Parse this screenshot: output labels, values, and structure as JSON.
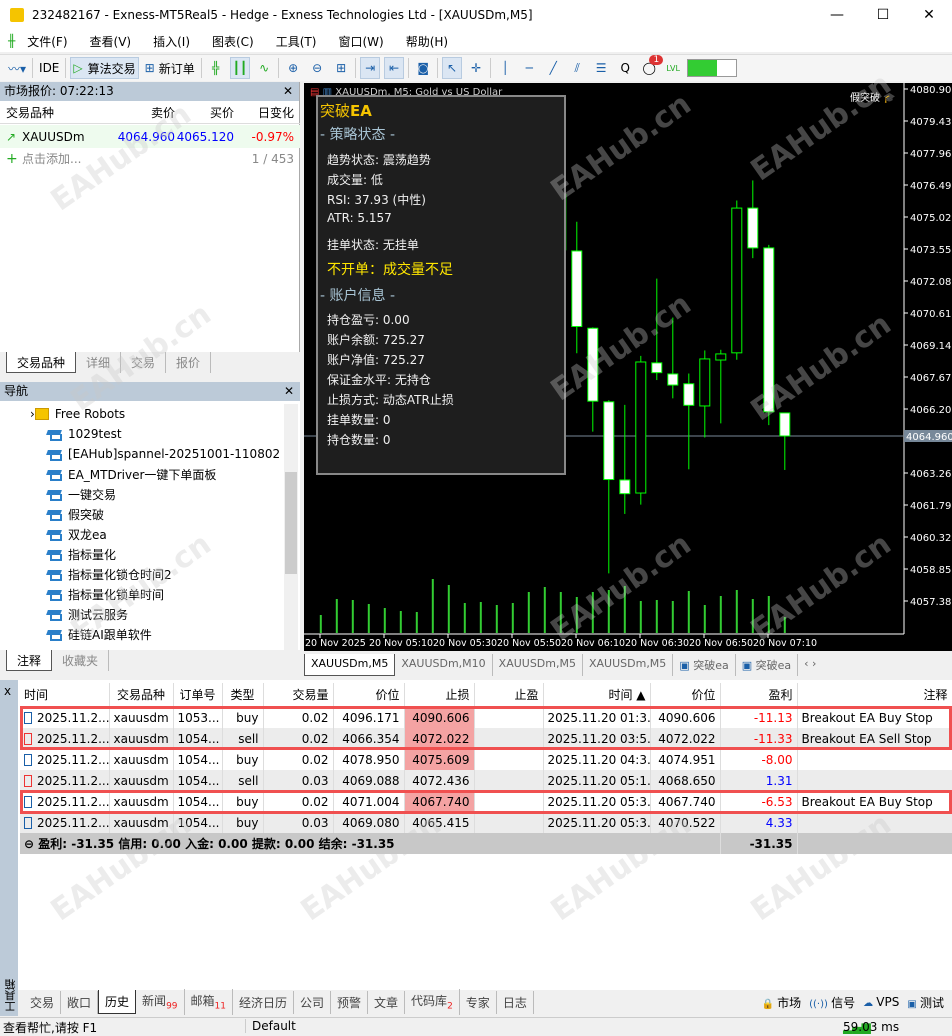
{
  "window": {
    "title": "232482167 - Exness-MT5Real5 - Hedge - Exness Technologies Ltd - [XAUUSDm,M5]",
    "min": "—",
    "max": "☐",
    "close": "✕"
  },
  "menu": [
    "文件(F)",
    "查看(V)",
    "插入(I)",
    "图表(C)",
    "工具(T)",
    "窗口(W)",
    "帮助(H)"
  ],
  "toolbar": {
    "ide": "IDE",
    "algo": "算法交易",
    "new_order": "新订单",
    "notif_count": "1",
    "lvl": "LVL"
  },
  "market_watch": {
    "title": "市场报价: 07:22:13",
    "columns": [
      "交易品种",
      "卖价",
      "买价",
      "日变化"
    ],
    "rows": [
      {
        "symbol": "XAUUSDm",
        "bid": "4064.960",
        "ask": "4065.120",
        "change": "-0.97%"
      }
    ],
    "add": "点击添加...",
    "count": "1 / 453",
    "tabs": [
      "交易品种",
      "详细",
      "交易",
      "报价"
    ]
  },
  "navigator": {
    "title": "导航",
    "items": [
      "Free Robots",
      "1029test",
      "[EAHub]spannel-20251001-110802",
      "EA_MTDriver一键下单面板",
      "一键交易",
      "假突破",
      "双龙ea",
      "指标量化",
      "指标量化锁仓时间2",
      "指标量化锁单时间",
      "测试云服务",
      "硅链AI跟单软件"
    ],
    "tabs": [
      "注释",
      "收藏夹"
    ]
  },
  "chart": {
    "header": "XAUUSDm, M5: Gold vs US Dollar",
    "ea_label": "假突破",
    "current_price": "4064.960",
    "colors": {
      "bg": "#000000",
      "candle": "#00ff00",
      "bear_fill": "#ffffff",
      "volume": "#32cd32",
      "bid_line": "#778899"
    },
    "price_labels": [
      "4080.900",
      "4079.430",
      "4077.960",
      "4076.490",
      "4075.020",
      "4073.550",
      "4072.080",
      "4070.610",
      "4069.140",
      "4067.670",
      "4066.200",
      "4063.260",
      "4061.790",
      "4060.320",
      "4058.850",
      "4057.380"
    ],
    "time_labels": [
      "20 Nov 2025",
      "20 Nov 05:10",
      "20 Nov 05:30",
      "20 Nov 05:50",
      "20 Nov 06:10",
      "20 Nov 06:30",
      "20 Nov 06:50",
      "20 Nov 07:10"
    ]
  },
  "chart_data": {
    "type": "candlestick",
    "ylim": [
      4056.5,
      4081.2
    ],
    "candles": [
      {
        "t": "06:10",
        "o": 4073.51,
        "h": 4076.3,
        "l": 4073.3,
        "c": 4076.06
      },
      {
        "t": "06:15",
        "o": 4073.46,
        "h": 4074.8,
        "l": 4068.76,
        "c": 4069.99
      },
      {
        "t": "06:20",
        "o": 4069.91,
        "h": 4069.95,
        "l": 4065.16,
        "c": 4066.56
      },
      {
        "t": "06:25",
        "o": 4066.53,
        "h": 4066.6,
        "l": 4058.65,
        "c": 4062.96
      },
      {
        "t": "06:30",
        "o": 4062.94,
        "h": 4066.39,
        "l": 4061.38,
        "c": 4062.31
      },
      {
        "t": "06:35",
        "o": 4062.34,
        "h": 4068.64,
        "l": 4061.81,
        "c": 4068.36
      },
      {
        "t": "06:40",
        "o": 4068.32,
        "h": 4072.19,
        "l": 4067.53,
        "c": 4067.87
      },
      {
        "t": "06:45",
        "o": 4067.81,
        "h": 4070.4,
        "l": 4066.69,
        "c": 4067.3
      },
      {
        "t": "06:50",
        "o": 4067.36,
        "h": 4067.83,
        "l": 4063.43,
        "c": 4066.37
      },
      {
        "t": "06:55",
        "o": 4066.34,
        "h": 4068.89,
        "l": 4064.89,
        "c": 4068.5
      },
      {
        "t": "07:00",
        "o": 4068.45,
        "h": 4068.92,
        "l": 4065.54,
        "c": 4068.73
      },
      {
        "t": "07:05",
        "o": 4068.78,
        "h": 4075.78,
        "l": 4068.46,
        "c": 4075.43
      },
      {
        "t": "07:10",
        "o": 4075.43,
        "h": 4076.7,
        "l": 4073.13,
        "c": 4073.6
      },
      {
        "t": "07:15",
        "o": 4073.6,
        "h": 4073.74,
        "l": 4065.46,
        "c": 4066.07
      },
      {
        "t": "07:20",
        "o": 4066.02,
        "h": 4066.02,
        "l": 4063.4,
        "c": 4064.96
      }
    ],
    "volume": [
      18,
      34,
      33,
      29,
      25,
      22,
      21,
      54,
      48,
      30,
      31,
      28,
      30,
      41,
      46,
      41,
      36,
      41,
      43,
      47,
      32,
      33,
      32,
      42,
      28,
      37,
      43,
      34,
      37,
      16
    ]
  },
  "ea_panel": {
    "title": "突破",
    "title_bold": "EA",
    "sec1": "- 策略状态 -",
    "trend": "趋势状态: 震荡趋势",
    "volume": "成交量: 低",
    "rsi": "RSI: 37.93 (中性)",
    "atr": "ATR: 5.157",
    "pending": "挂单状态: 无挂单",
    "signal": "不开单：成交量不足",
    "sec2": "- 账户信息 -",
    "pnl": "持仓盈亏: 0.00",
    "balance": "账户余额: 725.27",
    "equity": "账户净值: 725.27",
    "margin": "保证金水平: 无持仓",
    "sl_mode": "止损方式: 动态ATR止损",
    "pend_count": "挂单数量: 0",
    "pos_count": "持仓数量: 0"
  },
  "chart_tabs": [
    "XAUUSDm,M5",
    "XAUUSDm,M10",
    "XAUUSDm,M5",
    "XAUUSDm,M5",
    "突破ea",
    "突破ea"
  ],
  "history": {
    "columns": [
      "时间",
      "交易品种",
      "订单号",
      "类型",
      "交易量",
      "价位",
      "止损",
      "止盈",
      "时间 ▲",
      "价位",
      "盈利",
      "注释"
    ],
    "rows": [
      [
        "2025.11.2...",
        "xauusdm",
        "1053...",
        "buy",
        "0.02",
        "4096.171",
        "4090.606",
        "",
        "2025.11.20 01:3...",
        "4090.606",
        "-11.13",
        "Breakout EA Buy Stop"
      ],
      [
        "2025.11.2...",
        "xauusdm",
        "1054...",
        "sell",
        "0.02",
        "4066.354",
        "4072.022",
        "",
        "2025.11.20 03:5...",
        "4072.022",
        "-11.33",
        "Breakout EA Sell Stop"
      ],
      [
        "2025.11.2...",
        "xauusdm",
        "1054...",
        "buy",
        "0.02",
        "4078.950",
        "4075.609",
        "",
        "2025.11.20 04:3...",
        "4074.951",
        "-8.00",
        ""
      ],
      [
        "2025.11.2...",
        "xauusdm",
        "1054...",
        "sell",
        "0.03",
        "4069.088",
        "4072.436",
        "",
        "2025.11.20 05:1...",
        "4068.650",
        "1.31",
        ""
      ],
      [
        "2025.11.2...",
        "xauusdm",
        "1054...",
        "buy",
        "0.02",
        "4071.004",
        "4067.740",
        "",
        "2025.11.20 05:3...",
        "4067.740",
        "-6.53",
        "Breakout EA Buy Stop"
      ],
      [
        "2025.11.2...",
        "xauusdm",
        "1054...",
        "buy",
        "0.03",
        "4069.080",
        "4065.415",
        "",
        "2025.11.20 05:3...",
        "4070.522",
        "4.33",
        ""
      ]
    ],
    "sl_hit": [
      true,
      true,
      true,
      false,
      true,
      false
    ],
    "summary": "⊖ 盈利: -31.35  信用: 0.00  入金: 0.00  提款: 0.00  结余: -31.35",
    "summary_total": "-31.35"
  },
  "toolbox": {
    "label": "工具箱",
    "tabs": [
      {
        "l": "交易"
      },
      {
        "l": "敞口"
      },
      {
        "l": "历史"
      },
      {
        "l": "新闻",
        "b": "99"
      },
      {
        "l": "邮箱",
        "b": "11"
      },
      {
        "l": "经济日历"
      },
      {
        "l": "公司"
      },
      {
        "l": "预警"
      },
      {
        "l": "文章"
      },
      {
        "l": "代码库",
        "b": "2"
      },
      {
        "l": "专家"
      },
      {
        "l": "日志"
      }
    ],
    "right": [
      "市场",
      "信号",
      "VPS",
      "测试"
    ]
  },
  "status": {
    "help": "查看帮忙,请按 F1",
    "profile": "Default",
    "ping": "59.03 ms"
  },
  "watermark": "EAHub.cn"
}
